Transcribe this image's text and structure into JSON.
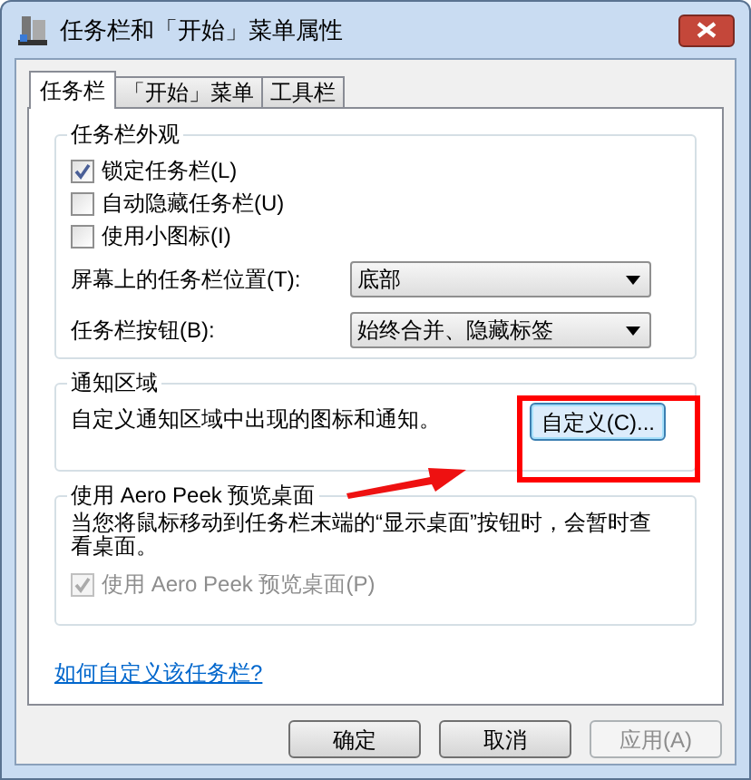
{
  "window": {
    "title": "任务栏和「开始」菜单属性"
  },
  "tabs": [
    {
      "label": "任务栏",
      "selected": true
    },
    {
      "label": "「开始」菜单",
      "selected": false
    },
    {
      "label": "工具栏",
      "selected": false
    }
  ],
  "appearance": {
    "title": "任务栏外观",
    "checkboxes": [
      {
        "label": "锁定任务栏(L)",
        "checked": true
      },
      {
        "label": "自动隐藏任务栏(U)",
        "checked": false
      },
      {
        "label": "使用小图标(I)",
        "checked": false
      }
    ],
    "dropdowns": [
      {
        "label": "屏幕上的任务栏位置(T):",
        "value": "底部"
      },
      {
        "label": "任务栏按钮(B):",
        "value": "始终合并、隐藏标签"
      }
    ]
  },
  "notification_area": {
    "title": "通知区域",
    "description": "自定义通知区域中出现的图标和通知。",
    "button": "自定义(C)..."
  },
  "aero_peek": {
    "title": "使用 Aero Peek 预览桌面",
    "description": "当您将鼠标移动到任务栏末端的“显示桌面”按钮时，会暂时查看桌面。",
    "checkbox": {
      "label": "使用 Aero Peek 预览桌面(P)",
      "checked": true,
      "disabled": true
    }
  },
  "help_link": "如何自定义该任务栏?",
  "buttons": [
    {
      "label": "确定",
      "disabled": false
    },
    {
      "label": "取消",
      "disabled": false
    },
    {
      "label": "应用(A)",
      "disabled": true
    }
  ]
}
